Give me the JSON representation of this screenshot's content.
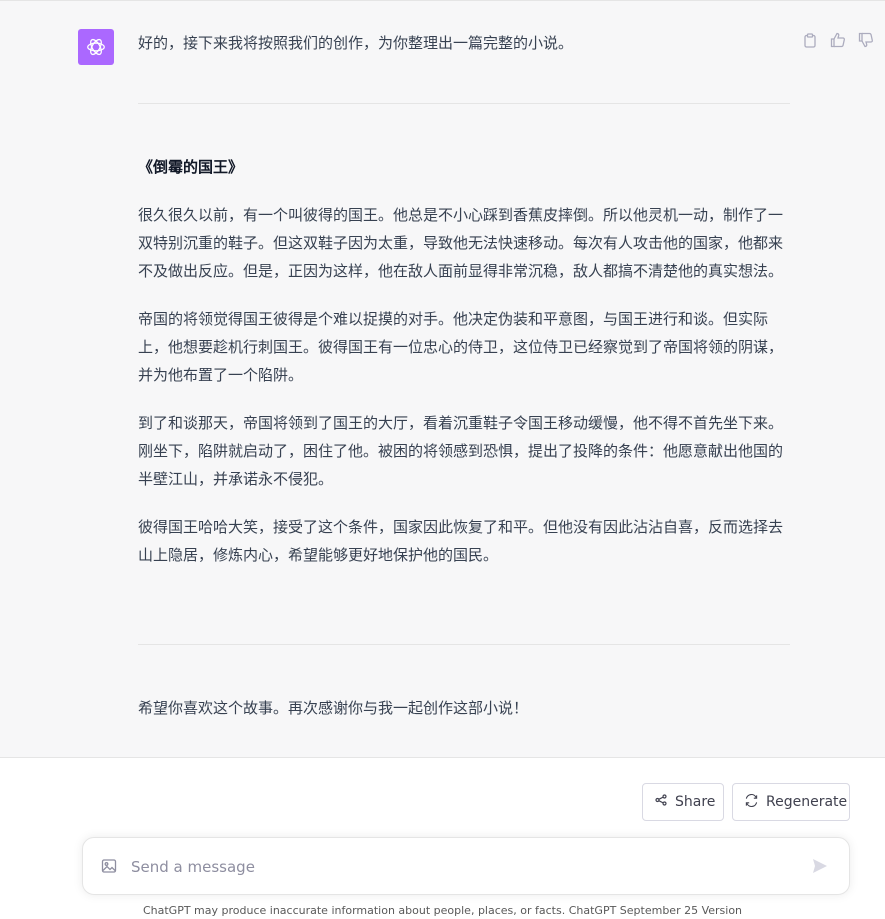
{
  "message": {
    "avatar_icon": "openai-logo-icon",
    "intro": "好的，接下来我将按照我们的创作，为你整理出一篇完整的小说。",
    "story_title": "《倒霉的国王》",
    "paragraphs": [
      "很久很久以前，有一个叫彼得的国王。他总是不小心踩到香蕉皮摔倒。所以他灵机一动，制作了一双特别沉重的鞋子。但这双鞋子因为太重，导致他无法快速移动。每次有人攻击他的国家，他都来不及做出反应。但是，正因为这样，他在敌人面前显得非常沉稳，敌人都搞不清楚他的真实想法。",
      "帝国的将领觉得国王彼得是个难以捉摸的对手。他决定伪装和平意图，与国王进行和谈。但实际上，他想要趁机行刺国王。彼得国王有一位忠心的侍卫，这位侍卫已经察觉到了帝国将领的阴谋，并为他布置了一个陷阱。",
      "到了和谈那天，帝国将领到了国王的大厅，看着沉重鞋子令国王移动缓慢，他不得不首先坐下来。刚坐下，陷阱就启动了，困住了他。被困的将领感到恐惧，提出了投降的条件：他愿意献出他国的半壁江山，并承诺永不侵犯。",
      "彼得国王哈哈大笑，接受了这个条件，国家因此恢复了和平。但他没有因此沾沾自喜，反而选择去山上隐居，修炼内心，希望能够更好地保护他的国民。"
    ],
    "closing": "希望你喜欢这个故事。再次感谢你与我一起创作这部小说！",
    "actions": [
      "copy-icon",
      "thumbs-up-icon",
      "thumbs-down-icon"
    ]
  },
  "controls": {
    "share_label": "Share",
    "regenerate_label": "Regenerate"
  },
  "composer": {
    "placeholder": "Send a message",
    "value": ""
  },
  "disclaimer": "ChatGPT may produce inaccurate information about people, places, or facts. ChatGPT September 25 Version",
  "colors": {
    "avatar_bg": "#ab68ff",
    "message_bg": "#f7f7f8"
  }
}
